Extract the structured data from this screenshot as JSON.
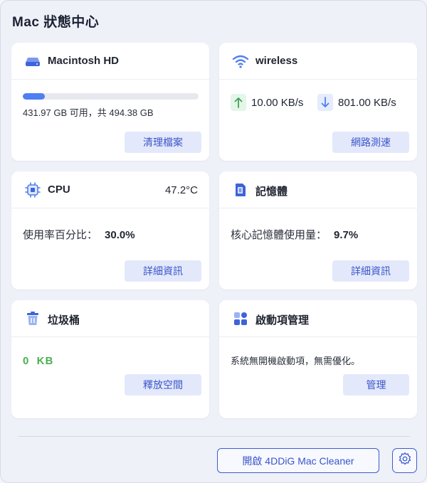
{
  "app": {
    "title": "Mac 狀態中心"
  },
  "disk": {
    "title": "Macintosh HD",
    "usage_text": "431.97 GB 可用，共 494.38 GB",
    "used_fraction": 0.126,
    "button": "清理檔案"
  },
  "network": {
    "title": "wireless",
    "upload": "10.00 KB/s",
    "download": "801.00 KB/s",
    "button": "網路測速"
  },
  "cpu": {
    "title": "CPU",
    "temperature": "47.2°C",
    "usage_label": "使用率百分比：",
    "usage_value": "30.0%",
    "button": "詳細資訊"
  },
  "memory": {
    "title": "記憶體",
    "usage_label": "核心記憶體使用量：",
    "usage_value": "9.7%",
    "button": "詳細資訊"
  },
  "trash": {
    "title": "垃圾桶",
    "size": "0  KB",
    "button": "釋放空間"
  },
  "startup": {
    "title": "啟動項管理",
    "status_text": "系統無開機啟動項，無需優化。",
    "button": "管理"
  },
  "footer": {
    "open_button": "開啟 4DDiG Mac Cleaner"
  },
  "icons": {
    "disk": "hard-drive-icon",
    "network": "wifi-icon",
    "cpu": "cpu-chip-icon",
    "memory": "memory-icon",
    "trash": "trash-icon",
    "startup": "startup-items-icon",
    "upload": "arrow-up-icon",
    "download": "arrow-down-icon",
    "settings": "gear-icon"
  },
  "colors": {
    "accent": "#3e5bd0",
    "button_bg": "#e3e9fb",
    "progress": "#4f7ff0",
    "success": "#4caf50",
    "upload": "#43a05a",
    "download": "#4f7ff0"
  }
}
